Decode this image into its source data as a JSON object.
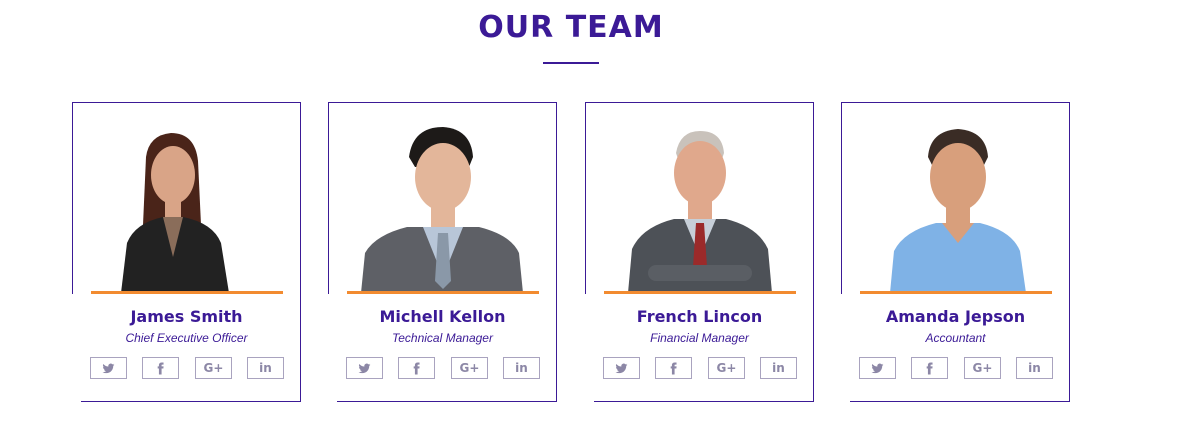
{
  "section": {
    "title": "OUR TEAM"
  },
  "members": [
    {
      "name": "James Smith",
      "role": "Chief Executive Officer",
      "shirt": "#222222",
      "hair": "#4a2419",
      "skin": "#d9a487",
      "tie": ""
    },
    {
      "name": "Michell Kellon",
      "role": "Technical Manager",
      "shirt": "#5e6066",
      "hair": "#1d1a18",
      "skin": "#e3b69a",
      "tie": "#8a98a8"
    },
    {
      "name": "French Lincon",
      "role": "Financial Manager",
      "shirt": "#4d5157",
      "hair": "#c9c2bb",
      "skin": "#e0a88c",
      "tie": "#9b2a2a"
    },
    {
      "name": "Amanda Jepson",
      "role": "Accountant",
      "shirt": "#7fb2e6",
      "hair": "#3a2c25",
      "skin": "#d89f7c",
      "tie": ""
    }
  ],
  "social": {
    "google_label": "G+",
    "linkedin_label": "in"
  },
  "colors": {
    "brand": "#3b1a96",
    "accent": "#f28b30",
    "icon": "#8c87a6"
  }
}
